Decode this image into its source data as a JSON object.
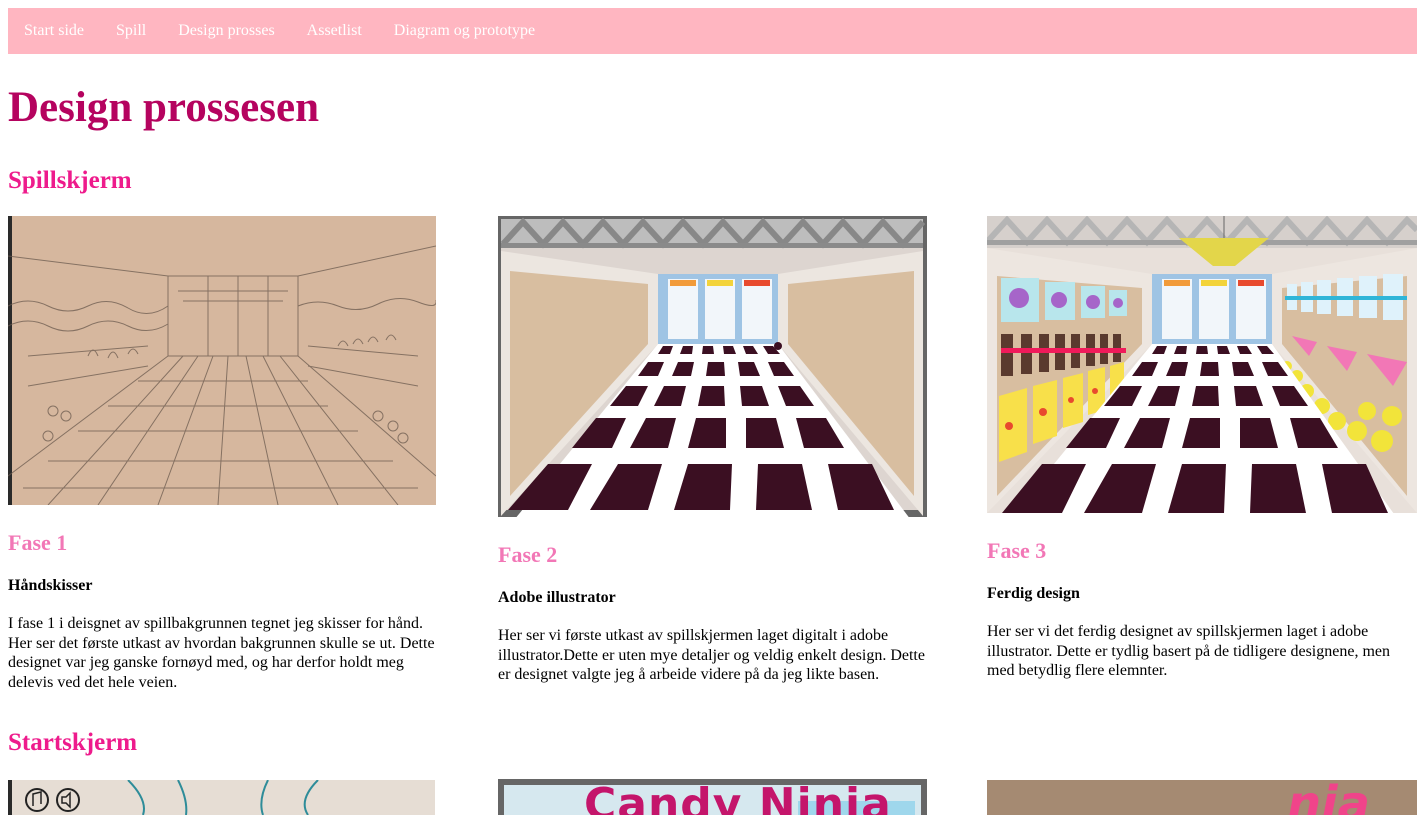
{
  "nav": {
    "items": [
      {
        "label": "Start side"
      },
      {
        "label": "Spill"
      },
      {
        "label": "Design prosses"
      },
      {
        "label": "Assetlist"
      },
      {
        "label": "Diagram og prototype"
      }
    ]
  },
  "page": {
    "title": "Design prossesen"
  },
  "sections": [
    {
      "title": "Spillskjerm",
      "phases": [
        {
          "title": "Fase 1",
          "subtitle": "Håndskisser",
          "text": "I fase 1 i deisgnet av spillbakgrunnen tegnet jeg skisser for hånd. Her ser det første utkast av hvordan bakgrunnen skulle se ut. Dette designet var jeg ganske fornøyd med, og har derfor holdt meg delevis ved det hele veien."
        },
        {
          "title": "Fase 2",
          "subtitle": "Adobe illustrator",
          "text": "Her ser vi første utkast av spillskjermen laget digitalt i adobe illustrator.Dette er uten mye detaljer og veldig enkelt design. Dette er designet valgte jeg å arbeide videre på da jeg likte basen."
        },
        {
          "title": "Fase 3",
          "subtitle": "Ferdig design",
          "text": "Her ser vi det ferdig designet av spillskjermen laget i adobe illustrator. Dette er tydlig basert på de tidligere designene, men med betydlig flere elemnter."
        }
      ]
    },
    {
      "title": "Startskjerm",
      "logo_text": "Candy Ninja",
      "logo_text_partial": "nja"
    }
  ],
  "colors": {
    "nav_bg": "#ffb6c1",
    "title": "#b5035f",
    "section": "#ee1b8c",
    "phase": "#f277b6",
    "floor_dark": "#3b0f22"
  }
}
